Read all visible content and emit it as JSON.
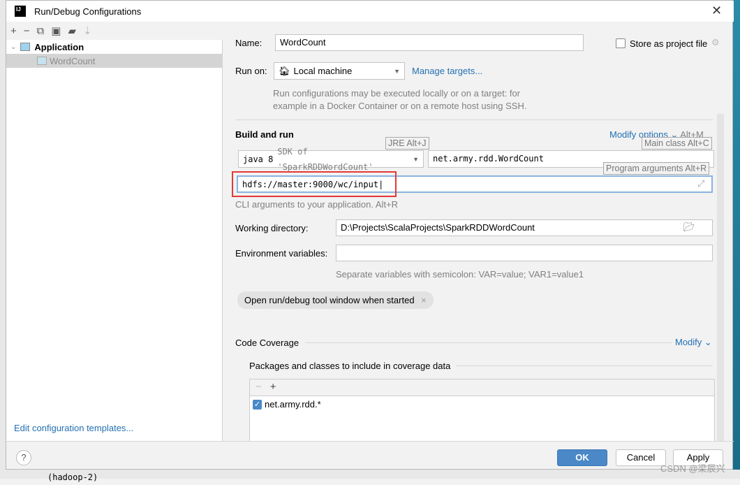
{
  "window": {
    "title": "Run/Debug Configurations",
    "logo": "IJ"
  },
  "tree": {
    "root": "Application",
    "child": "WordCount",
    "edit_templates": "Edit configuration templates..."
  },
  "form": {
    "name_label": "Name:",
    "name_value": "WordCount",
    "store_label": "Store as project file",
    "run_on_label": "Run on:",
    "run_on_value": "Local machine",
    "manage_targets": "Manage targets...",
    "run_on_hint1": "Run configurations may be executed locally or on a target: for",
    "run_on_hint2": "example in a Docker Container or on a remote host using SSH.",
    "build_run": "Build and run",
    "modify_options": "Modify options",
    "modify_shortcut": "Alt+M",
    "jre_value": "java 8",
    "jre_hint": "SDK of 'SparkRDDWordCount'",
    "main_class": "net.army.rdd.WordCount",
    "program_args": "hdfs://master:9000/wc/input",
    "args_hint": "CLI arguments to your application. Alt+R",
    "tip_jre": "JRE Alt+J",
    "tip_main": "Main class Alt+C",
    "tip_args": "Program arguments Alt+R",
    "workdir_label": "Working directory:",
    "workdir_value": "D:\\Projects\\ScalaProjects\\SparkRDDWordCount",
    "env_label": "Environment variables:",
    "env_value": "",
    "env_hint": "Separate variables with semicolon: VAR=value; VAR1=value1",
    "chip": "Open run/debug tool window when started",
    "coverage": "Code Coverage",
    "coverage_modify": "Modify",
    "packages_label": "Packages and classes to include in coverage data",
    "packages": [
      {
        "pattern": "net.army.rdd.*",
        "checked": true
      }
    ]
  },
  "buttons": {
    "ok": "OK",
    "cancel": "Cancel",
    "apply": "Apply",
    "help": "?"
  },
  "watermark": "CSDN @梁辰兴",
  "background": {
    "code": "(hadoop-2)"
  },
  "colors": {
    "accent": "#4a88c7",
    "link": "#2470b3",
    "highlight": "#e53935"
  }
}
